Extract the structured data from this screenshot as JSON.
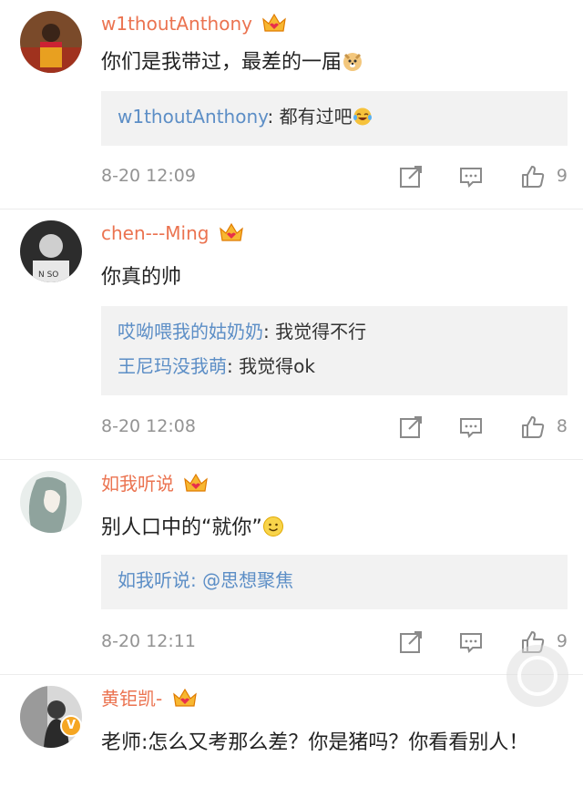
{
  "comments": [
    {
      "user": "w1thoutAnthony",
      "text": "你们是我带过，最差的一届",
      "replies": [
        {
          "name": "w1thoutAnthony",
          "text": ": 都有过吧"
        }
      ],
      "time": "8-20 12:09",
      "likes": "9"
    },
    {
      "user": "chen---Ming",
      "text": "你真的帅",
      "replies": [
        {
          "name": "哎呦喂我的姑奶奶",
          "text": ": 我觉得不行"
        },
        {
          "name": "王尼玛没我萌",
          "text": ": 我觉得ok"
        }
      ],
      "time": "8-20 12:08",
      "likes": "8"
    },
    {
      "user": "如我听说",
      "text": "别人口中的“就你”",
      "replies": [
        {
          "name": "如我听说",
          "text": ": @思想聚焦"
        }
      ],
      "time": "8-20 12:11",
      "likes": "9"
    },
    {
      "user": "黄钜凯-",
      "text": "老师:怎么又考那么差？你是猪吗？你看看别人！",
      "verified": "V"
    }
  ],
  "colors": {
    "username": "#eb7350",
    "reply_name": "#5c8ec6",
    "meta": "#939393",
    "reply_bg": "#f2f2f2"
  },
  "icons": [
    "crown-vip-icon",
    "doge-emoji-icon",
    "laughing-tears-emoji-icon",
    "smile-emoji-icon",
    "share-icon",
    "comment-icon",
    "like-icon",
    "verified-badge-icon"
  ]
}
